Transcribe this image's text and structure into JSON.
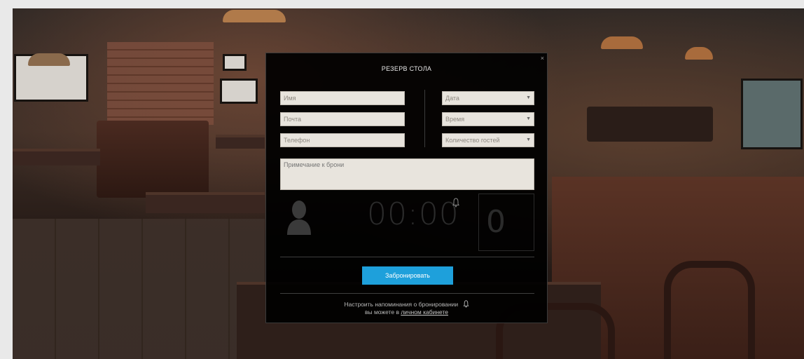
{
  "modal": {
    "title": "РЕЗЕРВ СТОЛА",
    "close_icon": "×",
    "fields": {
      "name_placeholder": "Имя",
      "email_placeholder": "Почта",
      "phone_placeholder": "Телефон",
      "date_placeholder": "Дата",
      "time_placeholder": "Время",
      "guests_placeholder": "Количество гостей",
      "note_placeholder": "Примечание к брони"
    },
    "dropdown_arrow": "▼",
    "timer_value": "00:00",
    "guest_count": "0",
    "submit_label": "Забронировать",
    "footer": {
      "line1": "Настроить напоминания о бронировании",
      "line2_prefix": "вы можете в ",
      "line2_link": "личном кабинете"
    },
    "icons": [
      "close-icon",
      "user-silhouette-icon",
      "bell-icon",
      "chevron-down-icon"
    ]
  },
  "colors": {
    "modal_bg": "#000000",
    "field_bg": "#e8e4dd",
    "accent": "#1ea0db"
  }
}
